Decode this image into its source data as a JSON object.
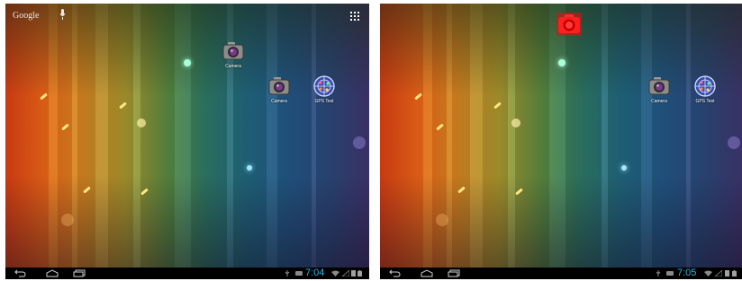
{
  "left_screen": {
    "search": {
      "label": "Google"
    },
    "icons": {
      "mic": "mic-icon",
      "apps": "all-apps-icon"
    },
    "shortcuts": [
      {
        "label": "Camera"
      },
      {
        "label": "Camera"
      },
      {
        "label": "GPS Test"
      }
    ],
    "status": {
      "time": "7:04"
    }
  },
  "right_screen": {
    "dragging_icon": "camera-drag-icon",
    "shortcuts": [
      {
        "label": "Camera"
      },
      {
        "label": "GPS Test"
      }
    ],
    "status": {
      "time": "7:05"
    }
  },
  "colors": {
    "clock": "#33b5e5",
    "drag_highlight": "#e01010",
    "navbar": "#000000"
  }
}
